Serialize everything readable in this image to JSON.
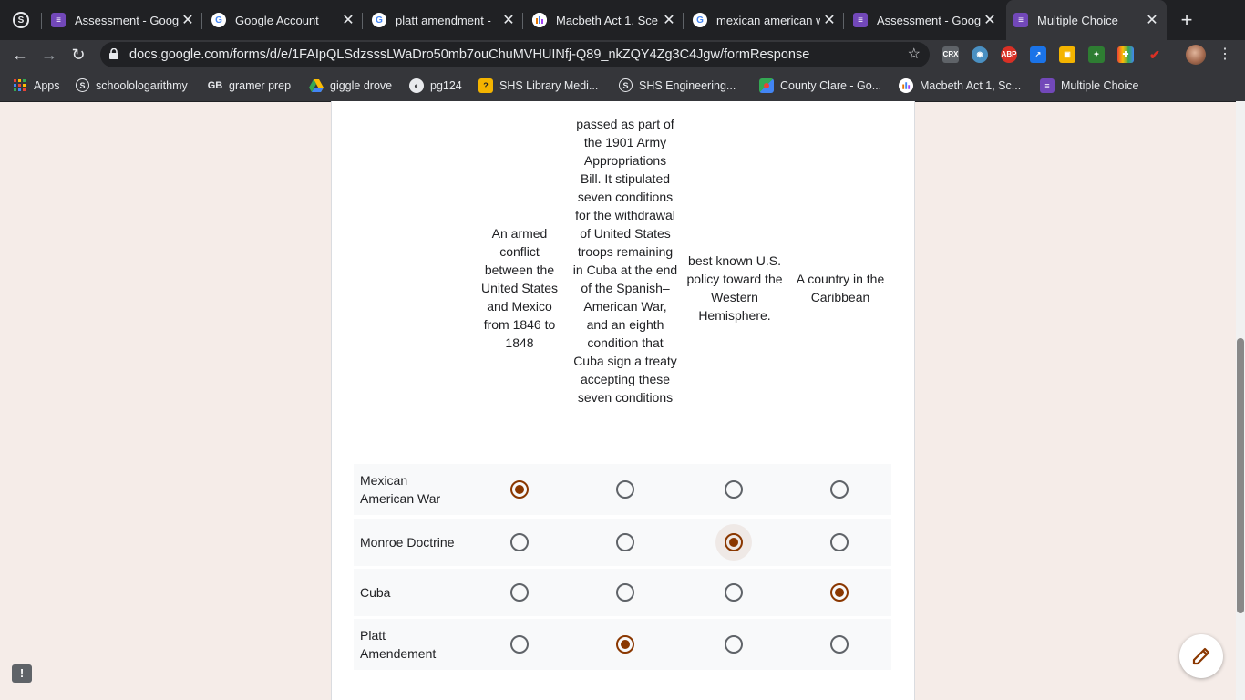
{
  "tabs": [
    {
      "title": "",
      "icon": "schoology-icon"
    },
    {
      "title": "Assessment - Goog",
      "icon": "forms-icon"
    },
    {
      "title": "Google Account",
      "icon": "google-icon"
    },
    {
      "title": "platt amendment - ",
      "icon": "google-icon"
    },
    {
      "title": "Macbeth Act 1, Sce",
      "icon": "macbeth-icon"
    },
    {
      "title": "mexican american w",
      "icon": "google-icon"
    },
    {
      "title": "Assessment - Goog",
      "icon": "forms-icon"
    },
    {
      "title": "Multiple Choice",
      "icon": "forms-icon"
    }
  ],
  "toolbar": {
    "url": "docs.google.com/forms/d/e/1FAIpQLSdzsssLWaDro50mb7ouChuMVHUINfj-Q89_nkZQY4Zg3C4Jgw/formResponse",
    "extensions": [
      "CRX",
      "ABP"
    ]
  },
  "bookmarks": [
    {
      "label": "Apps"
    },
    {
      "label": "schoolologarithmy"
    },
    {
      "label": "gramer prep"
    },
    {
      "label": "giggle drove"
    },
    {
      "label": "pg124"
    },
    {
      "label": "SHS Library Medi..."
    },
    {
      "label": "SHS Engineering..."
    },
    {
      "label": "County Clare - Go..."
    },
    {
      "label": "Macbeth Act 1, Sc..."
    },
    {
      "label": "Multiple Choice"
    }
  ],
  "grid": {
    "columns": [
      "An armed conflict between the United States and Mexico from 1846 to 1848",
      "passed as part of the 1901 Army Appropriations Bill. It stipulated seven conditions for the withdrawal of United States troops remaining in Cuba at the end of the Spanish–American War, and an eighth condition that Cuba sign a treaty accepting these seven conditions",
      "best known U.S. policy toward the Western Hemisphere.",
      "A country in the Caribbean"
    ],
    "rows": [
      {
        "label": "Mexican American War",
        "selected_column": 1
      },
      {
        "label": "Monroe Doctrine",
        "selected_column": 3
      },
      {
        "label": "Cuba",
        "selected_column": 4
      },
      {
        "label": "Platt Amendement",
        "selected_column": 2
      }
    ]
  },
  "colors": {
    "accent": "#8a3700",
    "page_bg": "#f5ece8"
  }
}
